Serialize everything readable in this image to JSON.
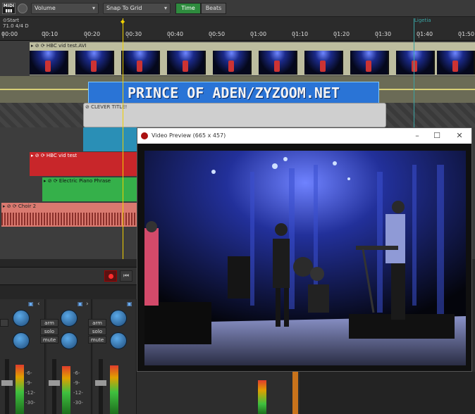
{
  "toolbar": {
    "midi_label": "MIDI",
    "parameter_select": "Volume",
    "snap_select": "Snap To Grid",
    "time_button": "Time",
    "beats_button": "Beats"
  },
  "ruler": {
    "start_label": "Start",
    "tempo_sig": "71.0 4/4 D",
    "end_label": "Ligetia",
    "times": [
      "00:00",
      "00:10",
      "00:20",
      "00:30",
      "00:40",
      "00:50",
      "01:00",
      "01:10",
      "01:20",
      "01:30",
      "01:40",
      "01:50"
    ]
  },
  "tracks": {
    "video_clip": "HBC vid test.AVI",
    "title_banner": "PRINCE OF ADEN/ZYZOOM.NET",
    "title_clip": "CLEVER TITLE!",
    "red_clip": "HBC vid test",
    "green_clip": "Electric Piano Phrase",
    "pink_clip": "Choir 2"
  },
  "preview": {
    "title": "Video Preview (665 x 457)",
    "minimize": "–",
    "maximize": "☐",
    "close": "✕"
  },
  "mixer": {
    "arm": "arm",
    "solo": "solo",
    "mute": "mute",
    "scale": [
      "-6-",
      "-6-",
      "-9-",
      "-9-",
      "-12-",
      "-12-",
      "-30-",
      "-30-"
    ],
    "nav_prev": "‹",
    "nav_next": "›",
    "pan_icon": "▣"
  },
  "colors": {
    "accent_green": "#2e8b3e",
    "playhead": "#f0d000",
    "end_marker": "#3aa3a3",
    "video_track": "#bdbd9f",
    "red_clip": "#c8262a",
    "green_clip": "#35b04a",
    "pink_clip": "#d9796f",
    "cyan_clip": "#2a8fb6"
  },
  "icons": [
    "midi-icon",
    "gear-icon",
    "chevron-down-icon",
    "record-icon",
    "skip-back-icon",
    "window-minimize-icon",
    "window-maximize-icon",
    "window-close-icon"
  ]
}
